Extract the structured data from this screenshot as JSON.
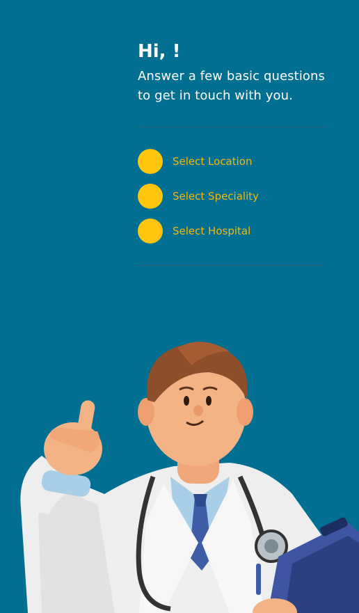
{
  "header": {
    "greeting": "Hi, !",
    "subtitle": "Answer a few basic questions to get in touch with you."
  },
  "steps": [
    {
      "label": "Select Location"
    },
    {
      "label": "Select Speciality"
    },
    {
      "label": "Select Hospital"
    }
  ],
  "colors": {
    "background": "#016f91",
    "accent": "#ffc50f",
    "step_label": "#f5b80c",
    "text": "#ffffff"
  },
  "illustration": {
    "icon": "doctor-illustration"
  }
}
